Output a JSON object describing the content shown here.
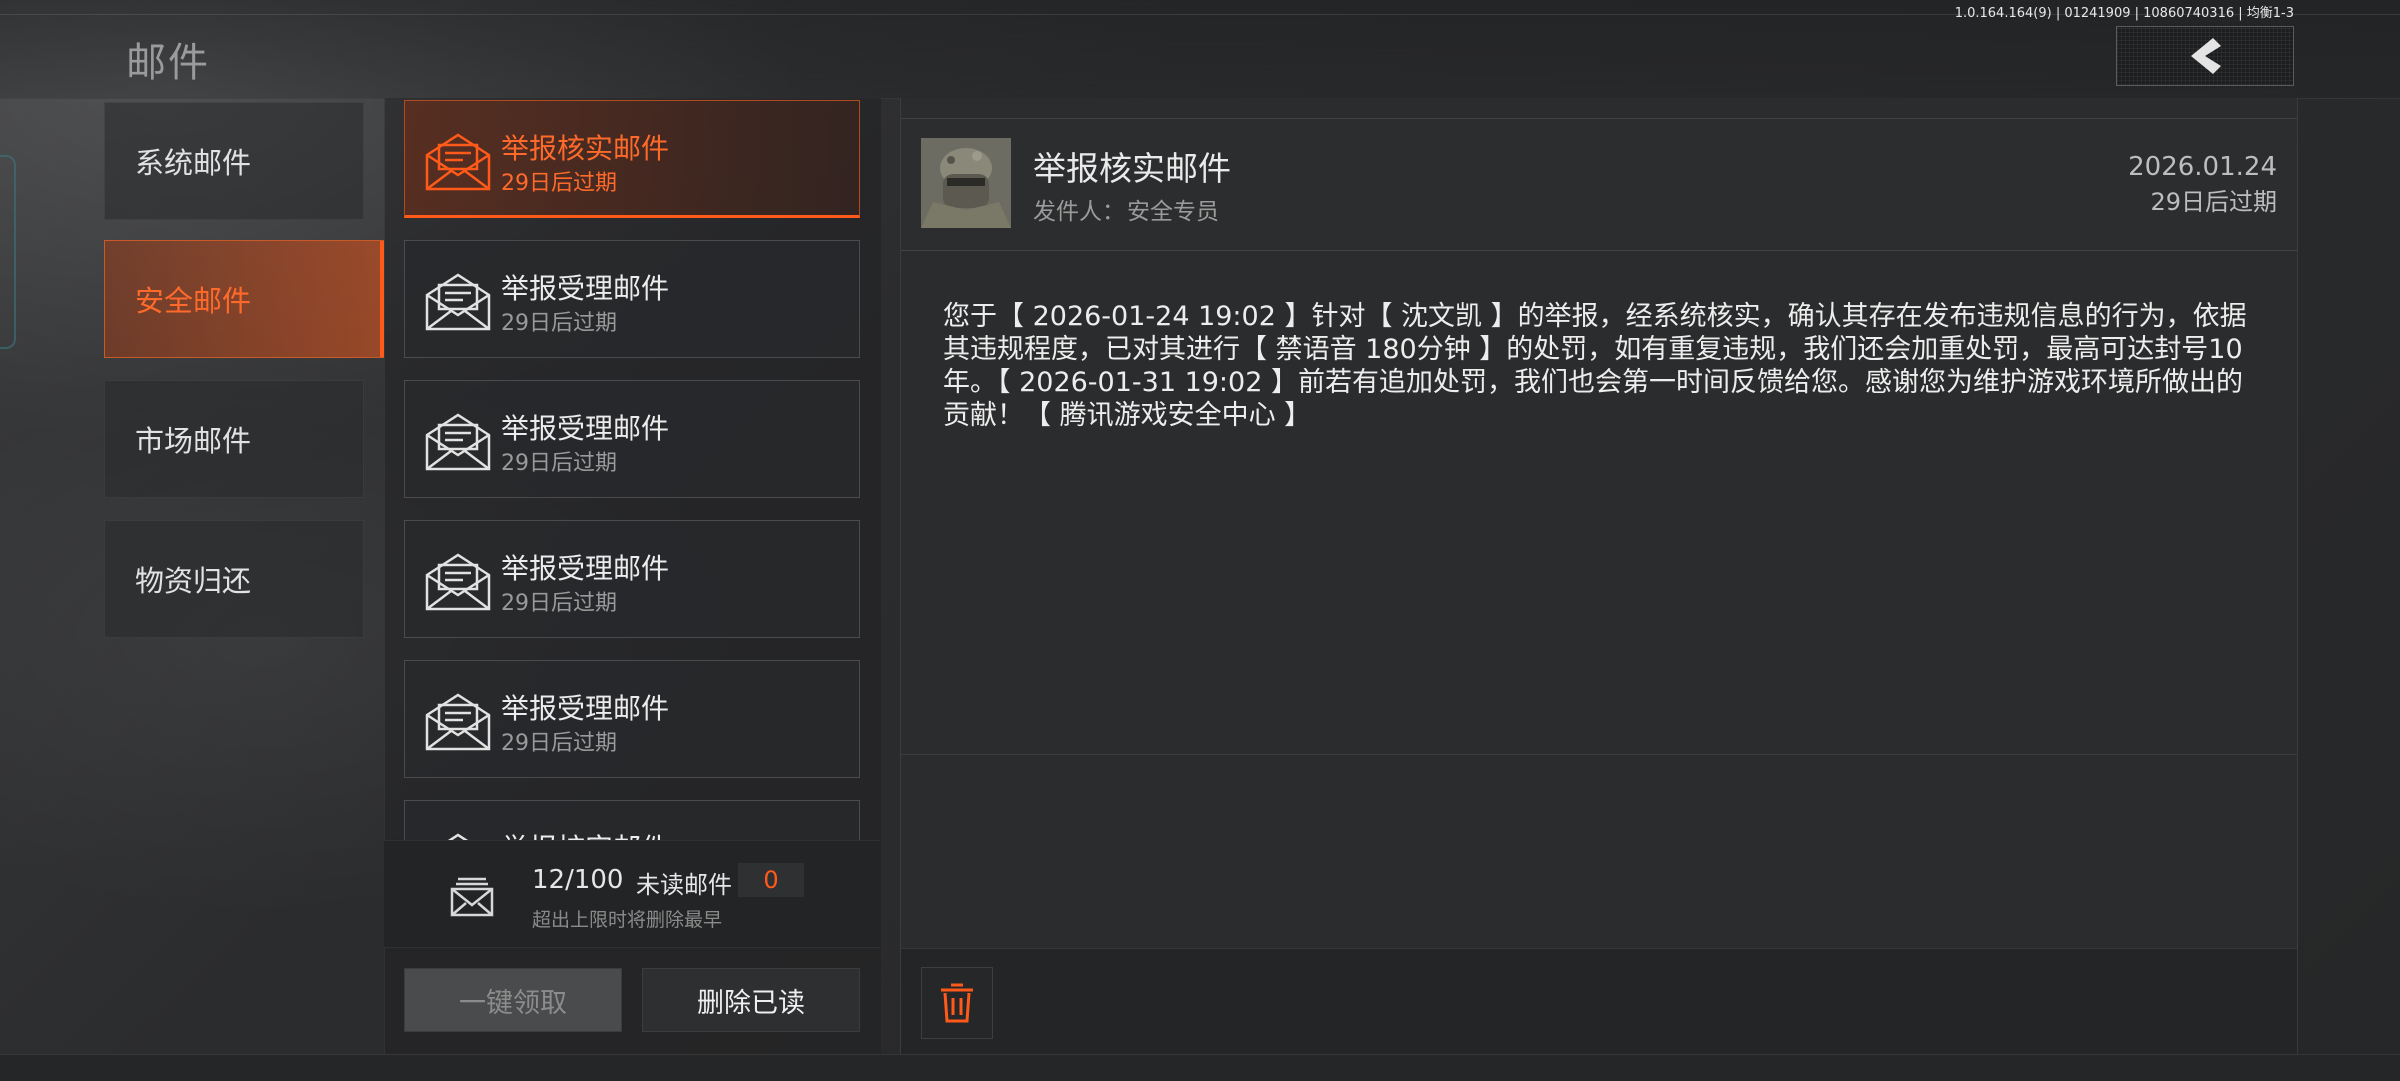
{
  "header": {
    "title": "邮件",
    "version": "1.0.164.164(9) | 01241909 | 10860740316 | 均衡1-3",
    "back_icon": "chevron-left-icon"
  },
  "categories": [
    {
      "label": "系统邮件",
      "active": false
    },
    {
      "label": "安全邮件",
      "active": true
    },
    {
      "label": "市场邮件",
      "active": false
    },
    {
      "label": "物资归还",
      "active": false
    }
  ],
  "mails": [
    {
      "title": "举报核实邮件",
      "expire": "29日后过期",
      "active": true
    },
    {
      "title": "举报受理邮件",
      "expire": "29日后过期",
      "active": false
    },
    {
      "title": "举报受理邮件",
      "expire": "29日后过期",
      "active": false
    },
    {
      "title": "举报受理邮件",
      "expire": "29日后过期",
      "active": false
    },
    {
      "title": "举报受理邮件",
      "expire": "29日后过期",
      "active": false
    },
    {
      "title": "举报核实邮件",
      "expire": "",
      "active": false
    }
  ],
  "counter": {
    "count": "12/100",
    "unread_label": "未读邮件",
    "unread_count": "0",
    "hint": "超出上限时将删除最早"
  },
  "buttons": {
    "claim_all": "一键领取",
    "delete_read": "删除已读"
  },
  "detail": {
    "title": "举报核实邮件",
    "sender_label": "发件人：",
    "sender_name": "安全专员",
    "date": "2026.01.24",
    "expire": "29日后过期",
    "body": "您于【 2026-01-24 19:02 】针对【 沈文凯 】的举报，经系统核实，确认其存在发布违规信息的行为，依据其违规程度，已对其进行【 禁语音 180分钟 】的处罚，如有重复违规，我们还会加重处罚，最高可达封号10年。【 2026-01-31 19:02 】前若有追加处罚，我们也会第一时间反馈给您。感谢您为维护游戏环境所做出的贡献！【 腾讯游戏安全中心 】"
  },
  "colors": {
    "accent": "#ff5a1a",
    "panel": "#2b2c2d",
    "text": "#e6e6e6",
    "muted": "#9a9a9a"
  }
}
